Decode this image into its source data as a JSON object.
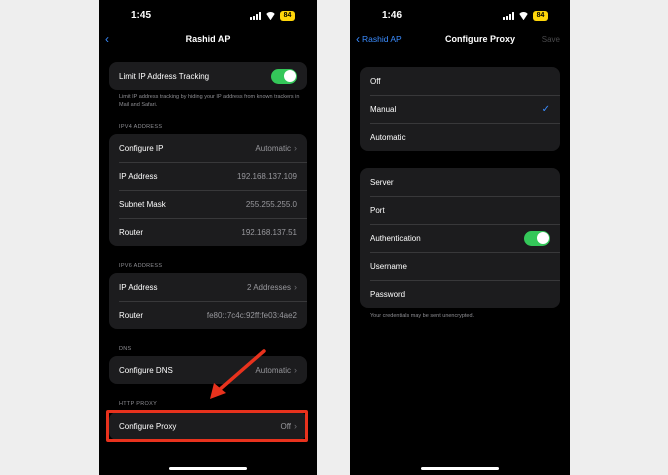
{
  "left": {
    "status": {
      "time": "1:45",
      "battery": "84"
    },
    "nav": {
      "title": "Rashid AP"
    },
    "limit_ip": {
      "label": "Limit IP Address Tracking",
      "on": true,
      "footnote": "Limit IP address tracking by hiding your IP address from known trackers in Mail and Safari."
    },
    "ipv4": {
      "header": "IPV4 ADDRESS",
      "rows": [
        {
          "label": "Configure IP",
          "value": "Automatic",
          "chevron": true
        },
        {
          "label": "IP Address",
          "value": "192.168.137.109",
          "chevron": false
        },
        {
          "label": "Subnet Mask",
          "value": "255.255.255.0",
          "chevron": false
        },
        {
          "label": "Router",
          "value": "192.168.137.51",
          "chevron": false
        }
      ]
    },
    "ipv6": {
      "header": "IPV6 ADDRESS",
      "rows": [
        {
          "label": "IP Address",
          "value": "2 Addresses",
          "chevron": true
        },
        {
          "label": "Router",
          "value": "fe80::7c4c:92ff:fe03:4ae2",
          "chevron": false
        }
      ]
    },
    "dns": {
      "header": "DNS",
      "row": {
        "label": "Configure DNS",
        "value": "Automatic"
      }
    },
    "http_proxy": {
      "header": "HTTP PROXY",
      "row": {
        "label": "Configure Proxy",
        "value": "Off"
      }
    }
  },
  "right": {
    "status": {
      "time": "1:46",
      "battery": "84"
    },
    "nav": {
      "back_label": "Rashid AP",
      "title": "Configure Proxy",
      "save_label": "Save"
    },
    "modes": [
      {
        "label": "Off",
        "selected": false
      },
      {
        "label": "Manual",
        "selected": true
      },
      {
        "label": "Automatic",
        "selected": false
      }
    ],
    "fields": {
      "server": "Server",
      "port": "Port",
      "authentication": "Authentication",
      "authentication_on": true,
      "username": "Username",
      "password": "Password"
    },
    "footnote": "Your credentials may be sent unencrypted."
  },
  "colors": {
    "accent": "#3a8cff",
    "toggle_on": "#34c759",
    "highlight": "#e8321d",
    "battery": "#ffd60a"
  }
}
